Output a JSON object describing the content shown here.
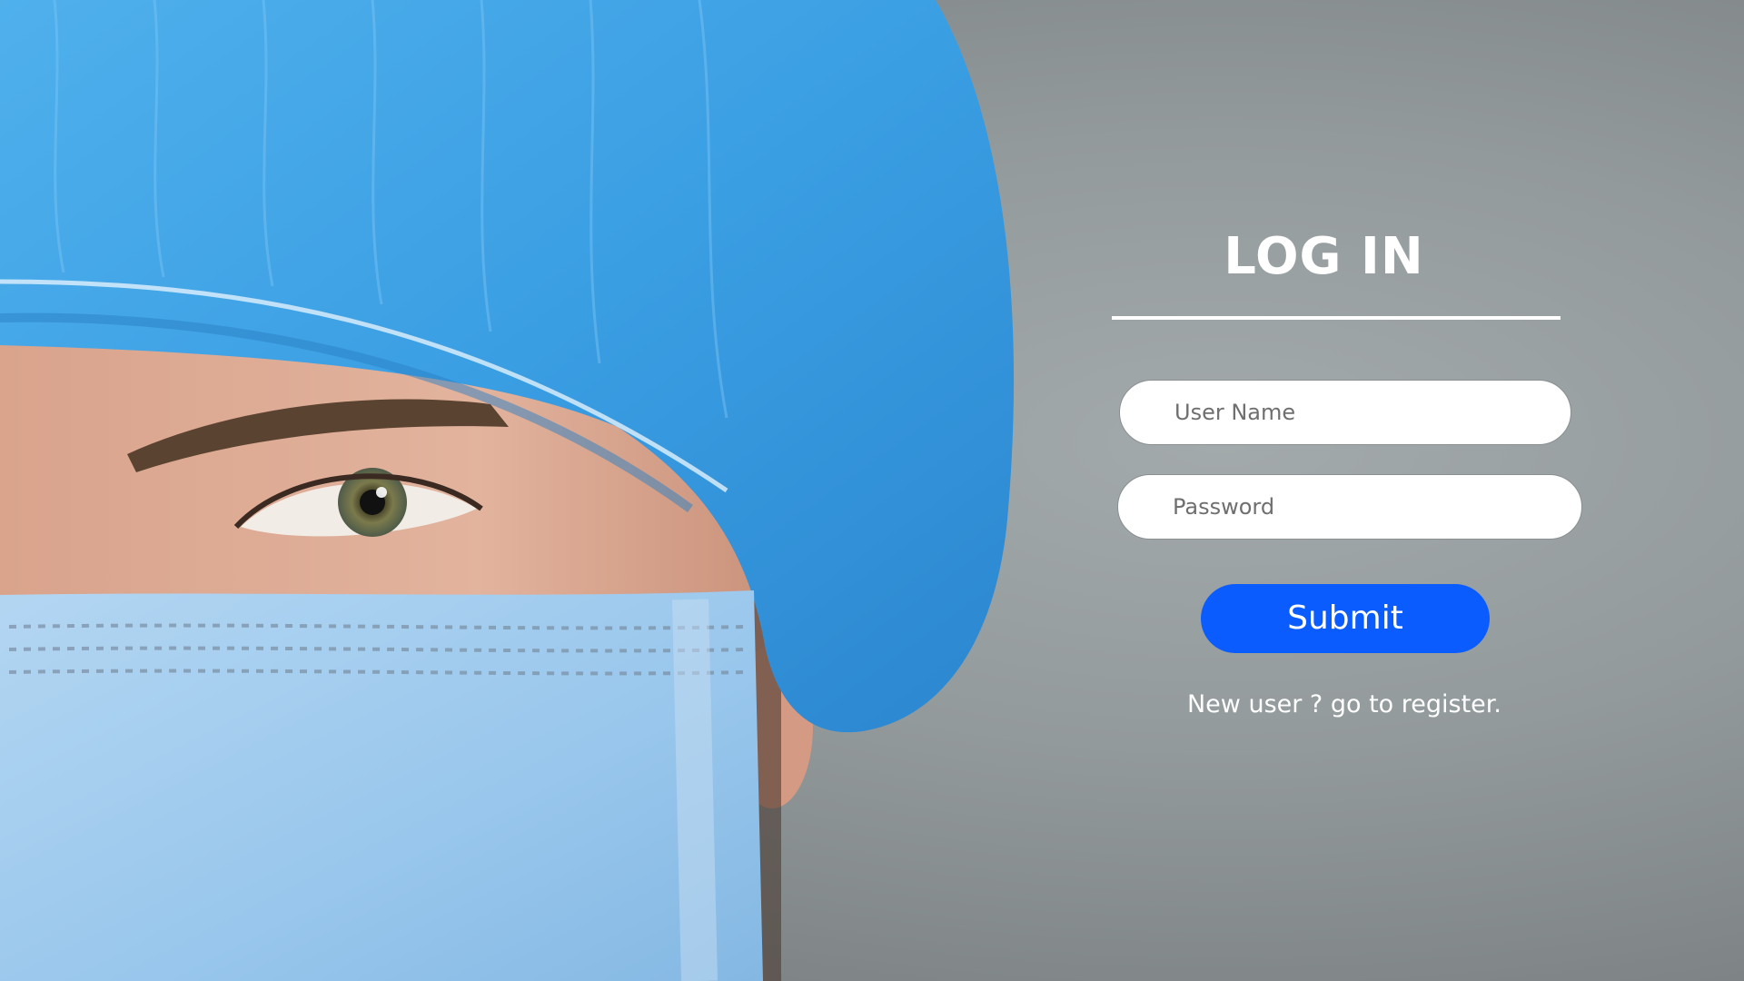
{
  "login": {
    "title": "LOG IN",
    "username_placeholder": "User Name",
    "password_placeholder": "Password",
    "submit_label": "Submit",
    "register_text": "New user ? go to register."
  },
  "colors": {
    "submit_button": "#0b5cff",
    "cap_blue": "#3a9ee3",
    "mask_blue": "#9fcbee",
    "background_gray": "#939a9c"
  }
}
